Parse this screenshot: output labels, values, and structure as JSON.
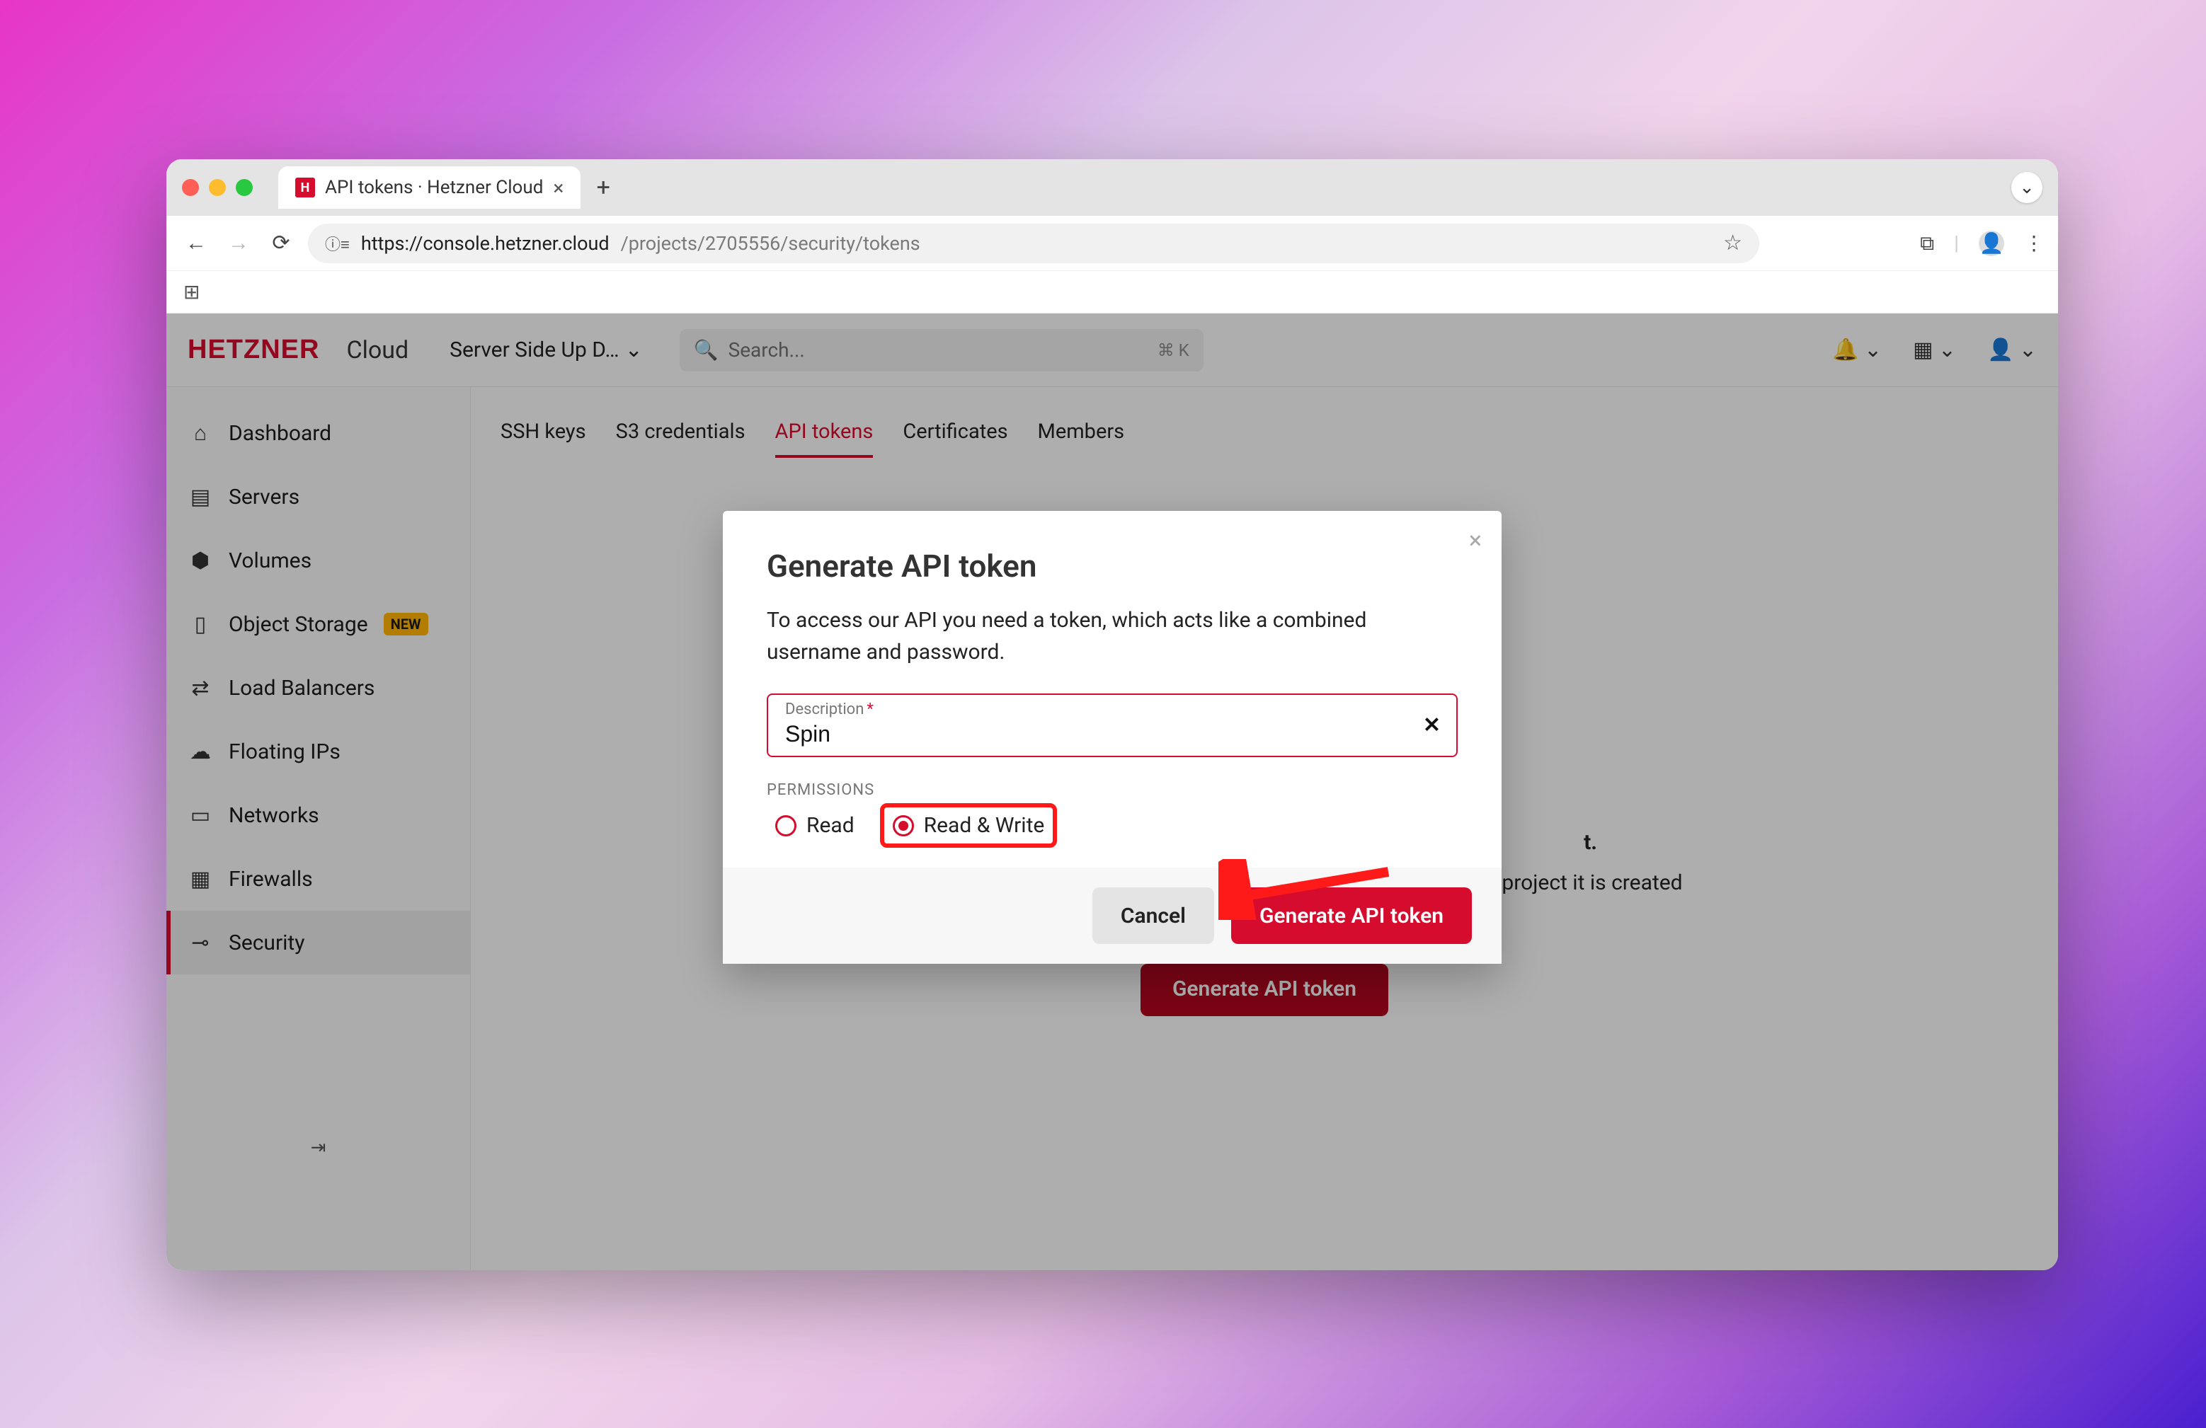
{
  "browser": {
    "tab_title": "API tokens · Hetzner Cloud",
    "url_prefix": "https://console.hetzner.cloud",
    "url_path": "/projects/2705556/security/tokens"
  },
  "topbar": {
    "brand": "HETZNER",
    "brand_sub": "Cloud",
    "project_selector": "Server Side Up D…",
    "search_placeholder": "Search...",
    "search_kbd": "⌘ K"
  },
  "sidebar": {
    "items": [
      {
        "icon": "⌂",
        "label": "Dashboard"
      },
      {
        "icon": "▤",
        "label": "Servers"
      },
      {
        "icon": "⬢",
        "label": "Volumes"
      },
      {
        "icon": "▯",
        "label": "Object Storage",
        "badge": "NEW"
      },
      {
        "icon": "⇄",
        "label": "Load Balancers"
      },
      {
        "icon": "☁",
        "label": "Floating IPs"
      },
      {
        "icon": "▭",
        "label": "Networks"
      },
      {
        "icon": "▦",
        "label": "Firewalls"
      },
      {
        "icon": "⊸",
        "label": "Security",
        "active": true
      }
    ]
  },
  "subtabs": {
    "items": [
      {
        "label": "SSH keys"
      },
      {
        "label": "S3 credentials"
      },
      {
        "label": "API tokens",
        "active": true
      },
      {
        "label": "Certificates"
      },
      {
        "label": "Members"
      }
    ]
  },
  "empty": {
    "line1_suffix": "t.",
    "line2": "an application or service with our API. The token grants access to the project it is created in, and should be treated like a password.",
    "button": "Generate API token"
  },
  "modal": {
    "title": "Generate API token",
    "lead": "To access our API you need a token, which acts like a combined username and password.",
    "field_label": "Description",
    "field_value": "Spin",
    "perm_title": "PERMISSIONS",
    "perm_read": "Read",
    "perm_rw": "Read & Write",
    "cancel": "Cancel",
    "submit": "Generate API token"
  }
}
